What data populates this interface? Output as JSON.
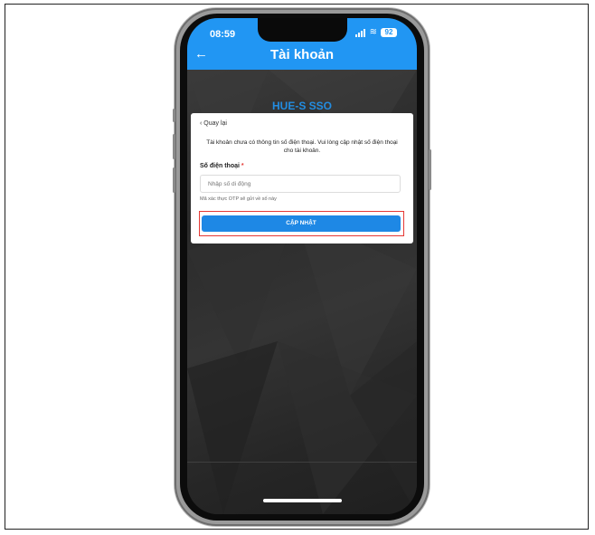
{
  "status_bar": {
    "time": "08:59",
    "battery": "92",
    "icons": [
      "signal-icon",
      "wifi-icon",
      "battery-icon"
    ]
  },
  "header": {
    "back_icon": "arrow-left-icon",
    "title": "Tài khoản",
    "bg_color": "#2196f3"
  },
  "brand": {
    "name": "HUE-S SSO"
  },
  "card": {
    "back_label": "Quay lại",
    "message": "Tài khoản chưa có thông tin số điện thoại. Vui lòng cập nhật số điện thoại cho tài khoản.",
    "phone_label": "Số điện thoại",
    "required_mark": "*",
    "phone_placeholder": "Nhập số di động",
    "phone_value": "",
    "hint": "Mã xác thực OTP sẽ gửi về số này",
    "update_button": "CẬP NHẬT",
    "accent_color": "#1e88e5",
    "highlight_color": "#e53935"
  }
}
